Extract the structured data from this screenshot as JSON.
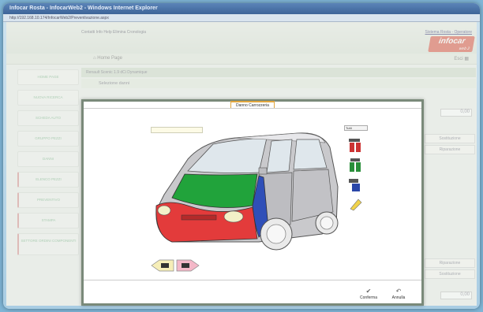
{
  "browser": {
    "title": "Infocar Rosta - InfocarWeb2 - Windows Internet Explorer",
    "address": "http://192.168.10.174/InfocarWeb2/Preventivazione.aspx"
  },
  "header": {
    "links": "Contatti  Info  Help  Elimina Cronologia",
    "account_link": "Sistema Rosta - Operatore",
    "logo_text": "infocar",
    "logo_sub": "web 2"
  },
  "subnav": {
    "home_label": "Home Page",
    "right_label": "Esci"
  },
  "sidebar": {
    "items": [
      {
        "label": "HOME PAGE"
      },
      {
        "label": "NUOVA RICERCA"
      },
      {
        "label": "SCHEDA AUTO"
      },
      {
        "label": "GRUPPO PEZZI"
      },
      {
        "label": "DANNI"
      },
      {
        "label": "ELENCO PEZZI"
      },
      {
        "label": "PREVENTIVO"
      },
      {
        "label": "STAMPA"
      },
      {
        "label": "SETTORE ORDINI COMPONENTI"
      }
    ]
  },
  "page": {
    "strip": "Renault Scenic 1.9 dCi Dynamique",
    "strip2": "Selezione danni",
    "prices": [
      "0,00",
      "0,00"
    ],
    "grid_top": [
      "Sostituzione",
      "Riparazione"
    ],
    "grid_bottom": [
      "Riparazione",
      "Sostituzione"
    ]
  },
  "modal": {
    "tab_label": "Danno Carrozzeria",
    "input_value": "",
    "tool_select": "Tutti",
    "tools": [
      {
        "name": "verniciatura"
      },
      {
        "name": "verniciatura-parziale"
      },
      {
        "name": "sostituzione"
      },
      {
        "name": "lucidatura"
      }
    ],
    "confirm_label": "Conferma",
    "cancel_label": "Annulla"
  },
  "colors": {
    "front_bumper": "#e33b3b",
    "hood": "#21a33b",
    "fender": "#2f4fb8",
    "accent": "#e0a640"
  }
}
